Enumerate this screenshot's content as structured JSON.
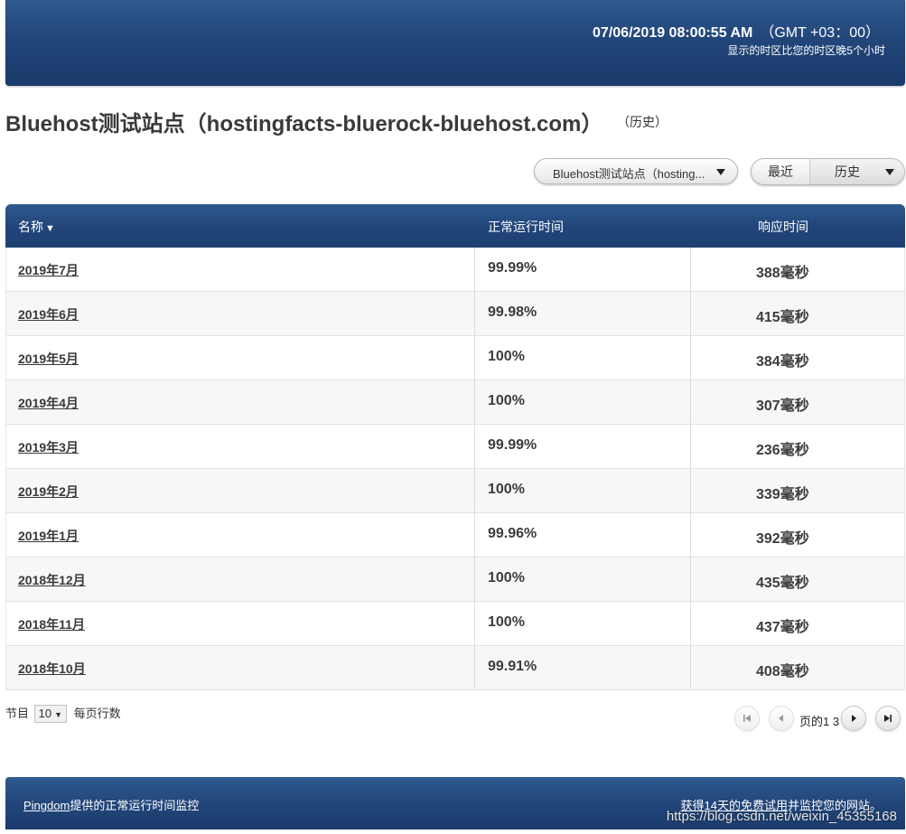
{
  "header": {
    "datetime": "07/06/2019 08:00:55 AM",
    "timezone": "（GMT +03：00）",
    "timezone_note": "显示的时区比您的时区晚5个小时"
  },
  "page": {
    "title": "Bluehost测试站点（hostingfacts-bluerock-bluehost.com）",
    "history_link": "（历史）"
  },
  "controls": {
    "site_select_value": "Bluehost测试站点（hosting...",
    "toggle_recent": "最近",
    "toggle_history": "历史"
  },
  "table": {
    "headers": {
      "name": "名称",
      "sort_indicator": "▼",
      "uptime": "正常运行时间",
      "response": "响应时间"
    },
    "rows": [
      {
        "name": "2019年7月",
        "uptime": "99.99%",
        "response": "388毫秒"
      },
      {
        "name": "2019年6月",
        "uptime": "99.98%",
        "response": "415毫秒"
      },
      {
        "name": "2019年5月",
        "uptime": "100%",
        "response": "384毫秒"
      },
      {
        "name": "2019年4月",
        "uptime": "100%",
        "response": "307毫秒"
      },
      {
        "name": "2019年3月",
        "uptime": "99.99%",
        "response": "236毫秒"
      },
      {
        "name": "2019年2月",
        "uptime": "100%",
        "response": "339毫秒"
      },
      {
        "name": "2019年1月",
        "uptime": "99.96%",
        "response": "392毫秒"
      },
      {
        "name": "2018年12月",
        "uptime": "100%",
        "response": "435毫秒"
      },
      {
        "name": "2018年11月",
        "uptime": "100%",
        "response": "437毫秒"
      },
      {
        "name": "2018年10月",
        "uptime": "99.91%",
        "response": "408毫秒"
      }
    ]
  },
  "pager": {
    "rows_prefix": "节目",
    "rows_per_page": "10",
    "rows_suffix": "每页行数",
    "page_info": "页的1 3"
  },
  "footer": {
    "pingdom_link": "Pingdom",
    "left_text": "提供的正常运行时间监控",
    "trial_link": "获得14天的免费试用",
    "right_text": "并监控您的网站。"
  },
  "watermark": "https://blog.csdn.net/weixin_45355168"
}
